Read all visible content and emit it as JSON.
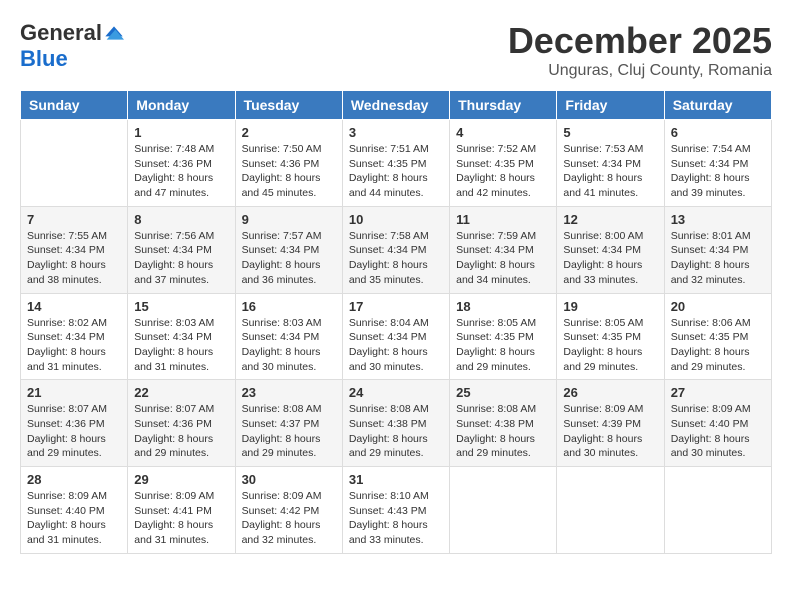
{
  "logo": {
    "general": "General",
    "blue": "Blue"
  },
  "title": "December 2025",
  "subtitle": "Unguras, Cluj County, Romania",
  "days_of_week": [
    "Sunday",
    "Monday",
    "Tuesday",
    "Wednesday",
    "Thursday",
    "Friday",
    "Saturday"
  ],
  "weeks": [
    [
      {
        "day": "",
        "info": ""
      },
      {
        "day": "1",
        "info": "Sunrise: 7:48 AM\nSunset: 4:36 PM\nDaylight: 8 hours\nand 47 minutes."
      },
      {
        "day": "2",
        "info": "Sunrise: 7:50 AM\nSunset: 4:36 PM\nDaylight: 8 hours\nand 45 minutes."
      },
      {
        "day": "3",
        "info": "Sunrise: 7:51 AM\nSunset: 4:35 PM\nDaylight: 8 hours\nand 44 minutes."
      },
      {
        "day": "4",
        "info": "Sunrise: 7:52 AM\nSunset: 4:35 PM\nDaylight: 8 hours\nand 42 minutes."
      },
      {
        "day": "5",
        "info": "Sunrise: 7:53 AM\nSunset: 4:34 PM\nDaylight: 8 hours\nand 41 minutes."
      },
      {
        "day": "6",
        "info": "Sunrise: 7:54 AM\nSunset: 4:34 PM\nDaylight: 8 hours\nand 39 minutes."
      }
    ],
    [
      {
        "day": "7",
        "info": "Sunrise: 7:55 AM\nSunset: 4:34 PM\nDaylight: 8 hours\nand 38 minutes."
      },
      {
        "day": "8",
        "info": "Sunrise: 7:56 AM\nSunset: 4:34 PM\nDaylight: 8 hours\nand 37 minutes."
      },
      {
        "day": "9",
        "info": "Sunrise: 7:57 AM\nSunset: 4:34 PM\nDaylight: 8 hours\nand 36 minutes."
      },
      {
        "day": "10",
        "info": "Sunrise: 7:58 AM\nSunset: 4:34 PM\nDaylight: 8 hours\nand 35 minutes."
      },
      {
        "day": "11",
        "info": "Sunrise: 7:59 AM\nSunset: 4:34 PM\nDaylight: 8 hours\nand 34 minutes."
      },
      {
        "day": "12",
        "info": "Sunrise: 8:00 AM\nSunset: 4:34 PM\nDaylight: 8 hours\nand 33 minutes."
      },
      {
        "day": "13",
        "info": "Sunrise: 8:01 AM\nSunset: 4:34 PM\nDaylight: 8 hours\nand 32 minutes."
      }
    ],
    [
      {
        "day": "14",
        "info": "Sunrise: 8:02 AM\nSunset: 4:34 PM\nDaylight: 8 hours\nand 31 minutes."
      },
      {
        "day": "15",
        "info": "Sunrise: 8:03 AM\nSunset: 4:34 PM\nDaylight: 8 hours\nand 31 minutes."
      },
      {
        "day": "16",
        "info": "Sunrise: 8:03 AM\nSunset: 4:34 PM\nDaylight: 8 hours\nand 30 minutes."
      },
      {
        "day": "17",
        "info": "Sunrise: 8:04 AM\nSunset: 4:34 PM\nDaylight: 8 hours\nand 30 minutes."
      },
      {
        "day": "18",
        "info": "Sunrise: 8:05 AM\nSunset: 4:35 PM\nDaylight: 8 hours\nand 29 minutes."
      },
      {
        "day": "19",
        "info": "Sunrise: 8:05 AM\nSunset: 4:35 PM\nDaylight: 8 hours\nand 29 minutes."
      },
      {
        "day": "20",
        "info": "Sunrise: 8:06 AM\nSunset: 4:35 PM\nDaylight: 8 hours\nand 29 minutes."
      }
    ],
    [
      {
        "day": "21",
        "info": "Sunrise: 8:07 AM\nSunset: 4:36 PM\nDaylight: 8 hours\nand 29 minutes."
      },
      {
        "day": "22",
        "info": "Sunrise: 8:07 AM\nSunset: 4:36 PM\nDaylight: 8 hours\nand 29 minutes."
      },
      {
        "day": "23",
        "info": "Sunrise: 8:08 AM\nSunset: 4:37 PM\nDaylight: 8 hours\nand 29 minutes."
      },
      {
        "day": "24",
        "info": "Sunrise: 8:08 AM\nSunset: 4:38 PM\nDaylight: 8 hours\nand 29 minutes."
      },
      {
        "day": "25",
        "info": "Sunrise: 8:08 AM\nSunset: 4:38 PM\nDaylight: 8 hours\nand 29 minutes."
      },
      {
        "day": "26",
        "info": "Sunrise: 8:09 AM\nSunset: 4:39 PM\nDaylight: 8 hours\nand 30 minutes."
      },
      {
        "day": "27",
        "info": "Sunrise: 8:09 AM\nSunset: 4:40 PM\nDaylight: 8 hours\nand 30 minutes."
      }
    ],
    [
      {
        "day": "28",
        "info": "Sunrise: 8:09 AM\nSunset: 4:40 PM\nDaylight: 8 hours\nand 31 minutes."
      },
      {
        "day": "29",
        "info": "Sunrise: 8:09 AM\nSunset: 4:41 PM\nDaylight: 8 hours\nand 31 minutes."
      },
      {
        "day": "30",
        "info": "Sunrise: 8:09 AM\nSunset: 4:42 PM\nDaylight: 8 hours\nand 32 minutes."
      },
      {
        "day": "31",
        "info": "Sunrise: 8:10 AM\nSunset: 4:43 PM\nDaylight: 8 hours\nand 33 minutes."
      },
      {
        "day": "",
        "info": ""
      },
      {
        "day": "",
        "info": ""
      },
      {
        "day": "",
        "info": ""
      }
    ]
  ]
}
